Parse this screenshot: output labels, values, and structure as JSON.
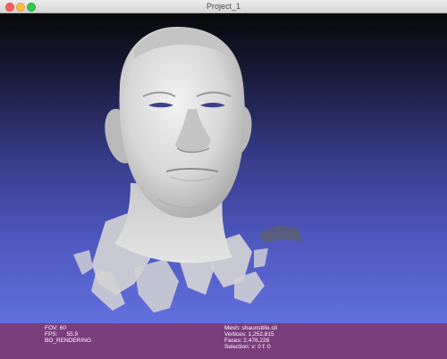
{
  "window": {
    "title": "Project_1",
    "controls": [
      "close",
      "minimize",
      "zoom"
    ]
  },
  "viewport": {
    "background_top": "#08080b",
    "background_bottom": "#6270de",
    "mesh_color": "#d8d8d8"
  },
  "status": {
    "left": {
      "fov": "FOV: 60",
      "fps_label": "FPS:",
      "fps_value": "55.9",
      "mode": "BO_RENDERING"
    },
    "right": {
      "mesh": "Mesh: shaunsttile.stl",
      "vertices": "Vertices: 1,252,815",
      "faces": "Faces: 2,476,228",
      "selection": "Selection: v: 0 f: 0"
    },
    "background": "#7b3e7c"
  }
}
